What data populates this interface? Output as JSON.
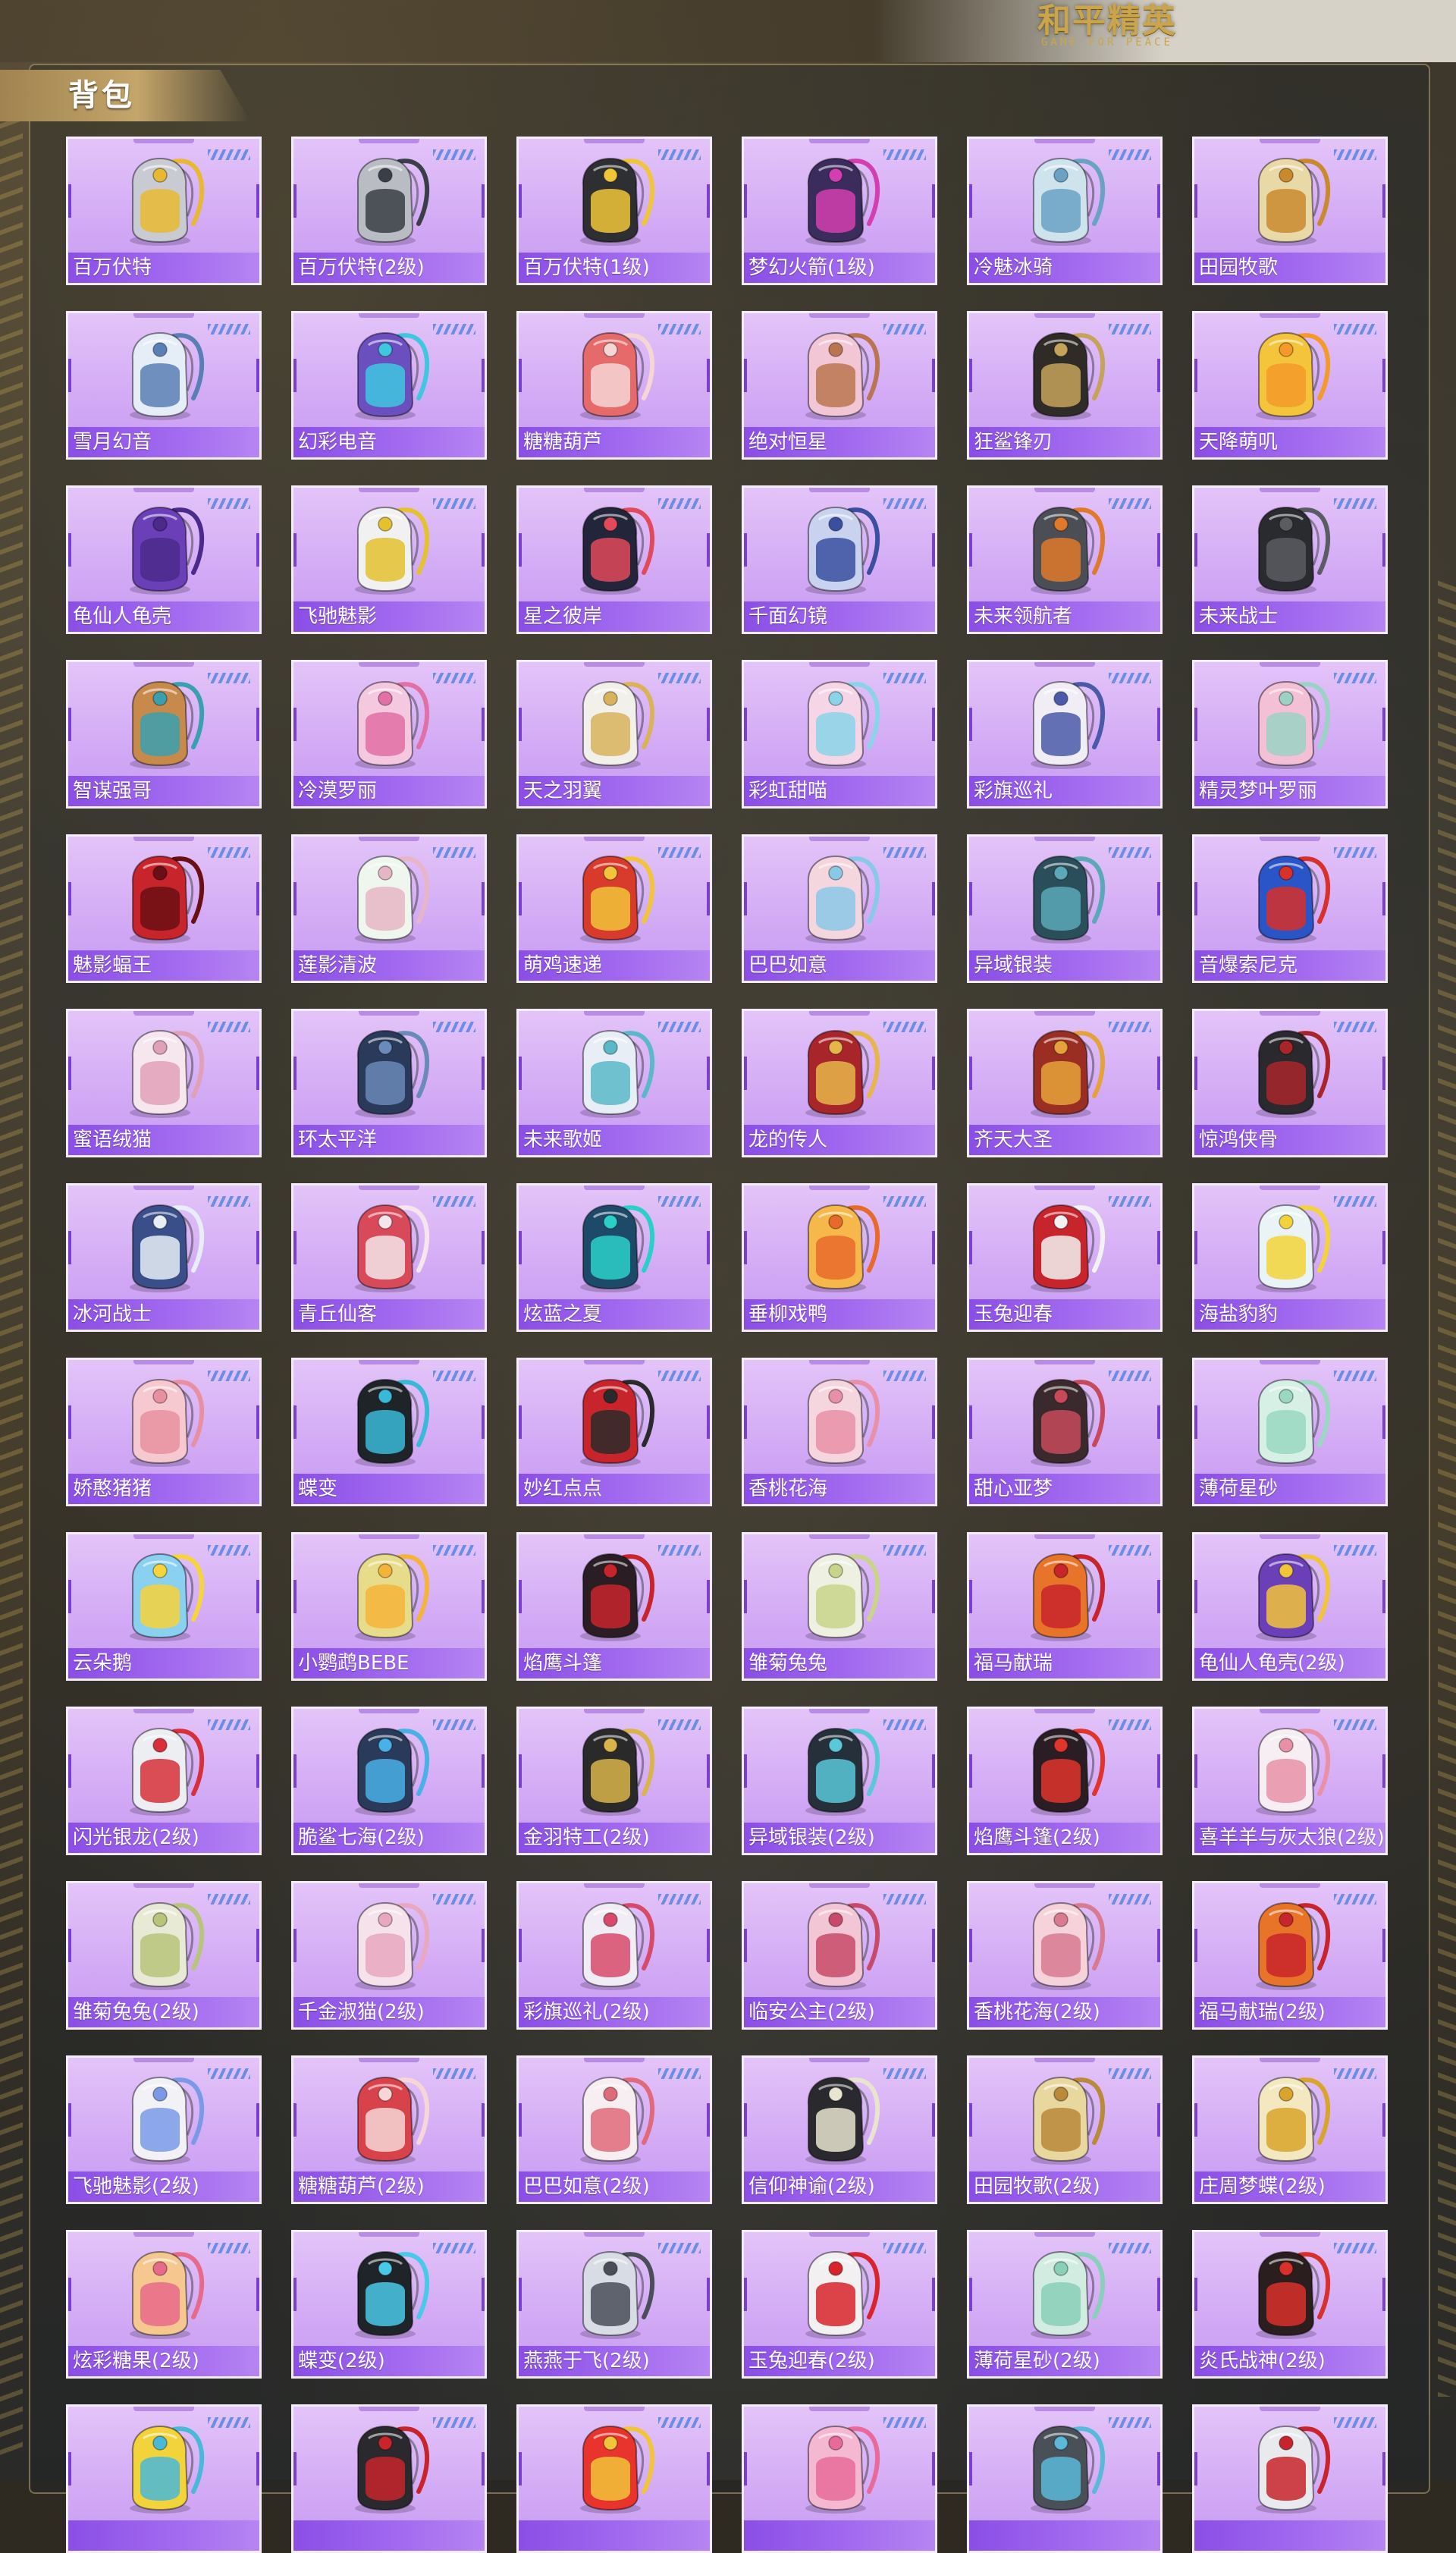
{
  "game": {
    "logo_cn": "和平精英",
    "logo_en": "GAME FOR PEACE"
  },
  "section": {
    "title": "背包"
  },
  "colors": {
    "card_bg": "#d9b3f6",
    "label_bg": "#9156ea",
    "panel_border": "#bea878",
    "header_gold": "#c4a56a"
  },
  "items": [
    {
      "name": "百万伏特",
      "color": "#c8ccd2",
      "accent": "#e8b832"
    },
    {
      "name": "百万伏特(2级)",
      "color": "#b9bdc3",
      "accent": "#3a3f47"
    },
    {
      "name": "百万伏特(1级)",
      "color": "#2e2f33",
      "accent": "#f0c53a"
    },
    {
      "name": "梦幻火箭(1级)",
      "color": "#3a2c5c",
      "accent": "#d33fb0"
    },
    {
      "name": "冷魅冰骑",
      "color": "#cfe3ec",
      "accent": "#6aa2c4"
    },
    {
      "name": "田园牧歌",
      "color": "#e9d9a6",
      "accent": "#c98a2e"
    },
    {
      "name": "雪月幻音",
      "color": "#e5eef6",
      "accent": "#5a7fb5"
    },
    {
      "name": "幻彩电音",
      "color": "#6b4fbf",
      "accent": "#3fc7e0"
    },
    {
      "name": "糖糖葫芦",
      "color": "#e66a6a",
      "accent": "#f6d5d5"
    },
    {
      "name": "绝对恒星",
      "color": "#f3c6d6",
      "accent": "#b9754f"
    },
    {
      "name": "狂鲨锋刃",
      "color": "#2f2c28",
      "accent": "#c6a35a"
    },
    {
      "name": "天降萌叽",
      "color": "#f4c43a",
      "accent": "#f39a2a"
    },
    {
      "name": "龟仙人龟壳",
      "color": "#6a3fb8",
      "accent": "#4a2a8a"
    },
    {
      "name": "飞驰魅影",
      "color": "#f1f1f1",
      "accent": "#e3c12f"
    },
    {
      "name": "星之彼岸",
      "color": "#23263a",
      "accent": "#e14a5a"
    },
    {
      "name": "千面幻镜",
      "color": "#c9d3ef",
      "accent": "#3a4fa0"
    },
    {
      "name": "未来领航者",
      "color": "#4b4e55",
      "accent": "#e07a2a"
    },
    {
      "name": "未来战士",
      "color": "#2a2b2e",
      "accent": "#5a5c60"
    },
    {
      "name": "智谋强哥",
      "color": "#c78a4a",
      "accent": "#3aa0b0"
    },
    {
      "name": "冷漠罗丽",
      "color": "#f4c9e0",
      "accent": "#e070a5"
    },
    {
      "name": "天之羽翼",
      "color": "#f2f0ea",
      "accent": "#d8b35a"
    },
    {
      "name": "彩虹甜喵",
      "color": "#f6d6e6",
      "accent": "#8ad4e8"
    },
    {
      "name": "彩旗巡礼",
      "color": "#f0eef4",
      "accent": "#4a5aa8"
    },
    {
      "name": "精灵梦叶罗丽",
      "color": "#f4c0d6",
      "accent": "#9ad2c4"
    },
    {
      "name": "魅影蝠王",
      "color": "#c8242c",
      "accent": "#6a0f14"
    },
    {
      "name": "莲影清波",
      "color": "#eef6ee",
      "accent": "#e6b6c6"
    },
    {
      "name": "萌鸡速递",
      "color": "#d83a2c",
      "accent": "#f2c43a"
    },
    {
      "name": "巴巴如意",
      "color": "#f4d6de",
      "accent": "#8ac8e8"
    },
    {
      "name": "异域银装",
      "color": "#2a4f5a",
      "accent": "#5aa8b8"
    },
    {
      "name": "音爆索尼克",
      "color": "#2a55c8",
      "accent": "#d8302a"
    },
    {
      "name": "蜜语绒猫",
      "color": "#f6e6ee",
      "accent": "#e0a0b8"
    },
    {
      "name": "环太平洋",
      "color": "#2a3a5a",
      "accent": "#6a8ab8"
    },
    {
      "name": "未来歌姬",
      "color": "#e8eef6",
      "accent": "#5ab8c8"
    },
    {
      "name": "龙的传人",
      "color": "#a8262a",
      "accent": "#e6b64a"
    },
    {
      "name": "齐天大圣",
      "color": "#9a2e22",
      "accent": "#e6a23a"
    },
    {
      "name": "惊鸿侠骨",
      "color": "#2a2a2e",
      "accent": "#a8262a"
    },
    {
      "name": "冰河战士",
      "color": "#3a4f8a",
      "accent": "#e8eef6"
    },
    {
      "name": "青丘仙客",
      "color": "#d84a5a",
      "accent": "#f4e6ea"
    },
    {
      "name": "炫蓝之夏",
      "color": "#1e4a6a",
      "accent": "#2ad0c8"
    },
    {
      "name": "垂柳戏鸭",
      "color": "#f6b84a",
      "accent": "#e86a2a"
    },
    {
      "name": "玉兔迎春",
      "color": "#c8242c",
      "accent": "#f2f2f2"
    },
    {
      "name": "海盐豹豹",
      "color": "#eaf4f6",
      "accent": "#f2d43a"
    },
    {
      "name": "娇憨猪猪",
      "color": "#f6c8d0",
      "accent": "#e890a0"
    },
    {
      "name": "蝶变",
      "color": "#1e2428",
      "accent": "#3ab8d8"
    },
    {
      "name": "妙红点点",
      "color": "#c8242c",
      "accent": "#2a2a2a"
    },
    {
      "name": "香桃花海",
      "color": "#f6d6de",
      "accent": "#e890a8"
    },
    {
      "name": "甜心亚梦",
      "color": "#3a2a2e",
      "accent": "#c84a5a"
    },
    {
      "name": "薄荷星砂",
      "color": "#d6f0e6",
      "accent": "#9ad8c0"
    },
    {
      "name": "云朵鹅",
      "color": "#8ad0f0",
      "accent": "#f6d43a"
    },
    {
      "name": "小鹦鹉BEBE",
      "color": "#e6dc8a",
      "accent": "#f4b43a"
    },
    {
      "name": "焰鹰斗篷",
      "color": "#2a1e24",
      "accent": "#c8242c"
    },
    {
      "name": "雏菊兔兔",
      "color": "#eef0e2",
      "accent": "#c8d48a"
    },
    {
      "name": "福马献瑞",
      "color": "#e8742a",
      "accent": "#c8242c"
    },
    {
      "name": "龟仙人龟壳(2级)",
      "color": "#6a3fb8",
      "accent": "#f2c43a"
    },
    {
      "name": "闪光银龙(2级)",
      "color": "#eceef2",
      "accent": "#d8303a"
    },
    {
      "name": "脆鲨七海(2级)",
      "color": "#2a3a5a",
      "accent": "#4ab0e8"
    },
    {
      "name": "金羽特工(2级)",
      "color": "#2a2a2a",
      "accent": "#d8b44a"
    },
    {
      "name": "异域银装(2级)",
      "color": "#26303a",
      "accent": "#5ac8d8"
    },
    {
      "name": "焰鹰斗篷(2级)",
      "color": "#2a1e24",
      "accent": "#e0342c"
    },
    {
      "name": "喜羊羊与灰太狼(2级)",
      "color": "#f6eef2",
      "accent": "#e890a8"
    },
    {
      "name": "雏菊兔兔(2级)",
      "color": "#e8ead6",
      "accent": "#b8c47a"
    },
    {
      "name": "千金淑猫(2级)",
      "color": "#f6e2ea",
      "accent": "#e8a8c0"
    },
    {
      "name": "彩旗巡礼(2级)",
      "color": "#f0eef4",
      "accent": "#d84a6a"
    },
    {
      "name": "临安公主(2级)",
      "color": "#f2c6d4",
      "accent": "#c84a6a"
    },
    {
      "name": "香桃花海(2级)",
      "color": "#f6d2da",
      "accent": "#d87a90"
    },
    {
      "name": "福马献瑞(2级)",
      "color": "#e8742a",
      "accent": "#c8242c"
    },
    {
      "name": "飞驰魅影(2级)",
      "color": "#f2f2f6",
      "accent": "#7a9ae8"
    },
    {
      "name": "糖糖葫芦(2级)",
      "color": "#d8424a",
      "accent": "#f6d6d6"
    },
    {
      "name": "巴巴如意(2级)",
      "color": "#f6eef0",
      "accent": "#e06a7a"
    },
    {
      "name": "信仰神谕(2级)",
      "color": "#2a2a2e",
      "accent": "#e8e4d0"
    },
    {
      "name": "田园牧歌(2级)",
      "color": "#e8d8a0",
      "accent": "#b88a3a"
    },
    {
      "name": "庄周梦蝶(2级)",
      "color": "#f4e8c0",
      "accent": "#d8a42a"
    },
    {
      "name": "炫彩糖果(2级)",
      "color": "#f6c890",
      "accent": "#e86a8a"
    },
    {
      "name": "蝶变(2级)",
      "color": "#1e2428",
      "accent": "#4ac8e8"
    },
    {
      "name": "燕燕于飞(2级)",
      "color": "#d8dce4",
      "accent": "#4a4e58"
    },
    {
      "name": "玉兔迎春(2级)",
      "color": "#f2f0f0",
      "accent": "#d8242c"
    },
    {
      "name": "薄荷星砂(2级)",
      "color": "#d2ece2",
      "accent": "#8ad0b8"
    },
    {
      "name": "炎氏战神(2级)",
      "color": "#2a1e1e",
      "accent": "#d8302a"
    },
    {
      "name": "",
      "color": "#f2d43a",
      "accent": "#4ab8d8"
    },
    {
      "name": "",
      "color": "#2a2a2e",
      "accent": "#c8242c"
    },
    {
      "name": "",
      "color": "#e8342c",
      "accent": "#f2c43a"
    },
    {
      "name": "",
      "color": "#f4b8d0",
      "accent": "#e86a9a"
    },
    {
      "name": "",
      "color": "#4a5058",
      "accent": "#5ab8d8"
    },
    {
      "name": "",
      "color": "#e8eaee",
      "accent": "#c8242c"
    }
  ]
}
